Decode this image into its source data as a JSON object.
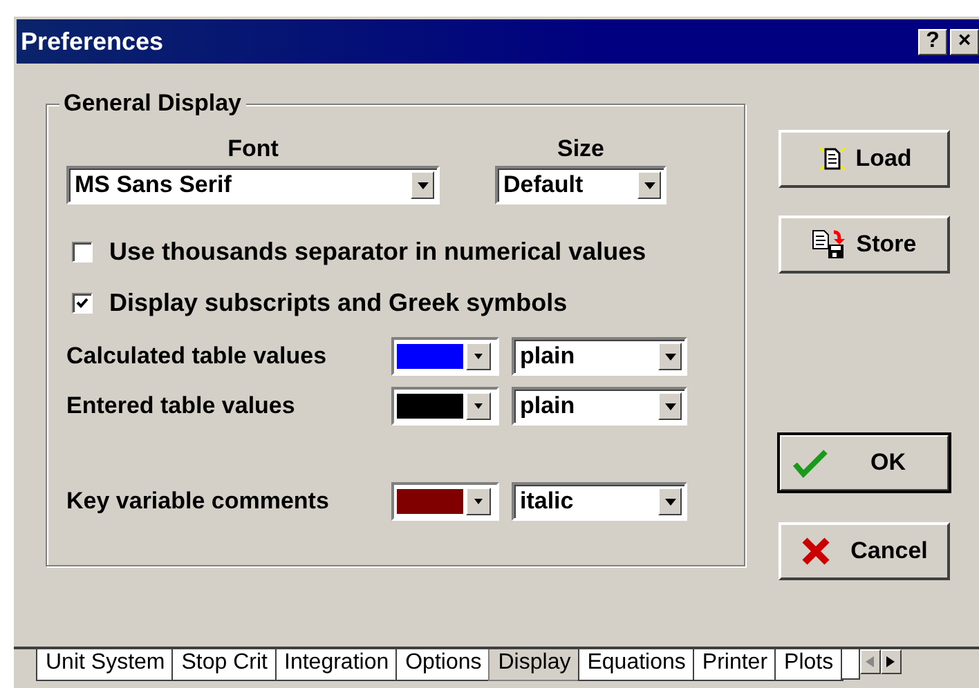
{
  "window": {
    "title": "Preferences",
    "help_button": "?",
    "close_button": "×"
  },
  "group": {
    "title": "General Display",
    "font": {
      "label": "Font",
      "value": "MS Sans Serif"
    },
    "size": {
      "label": "Size",
      "value": "Default"
    },
    "checkboxes": [
      {
        "label": "Use thousands separator in numerical values",
        "checked": false
      },
      {
        "label": "Display subscripts and Greek symbols",
        "checked": true
      }
    ],
    "styles": [
      {
        "label": "Calculated table values",
        "color": "#0000ff",
        "style": "plain"
      },
      {
        "label": "Entered table values",
        "color": "#000000",
        "style": "plain"
      },
      {
        "label": "Key variable comments",
        "color": "#800000",
        "style": "italic"
      }
    ]
  },
  "buttons": [
    {
      "kind": "load",
      "label": "Load"
    },
    {
      "kind": "store",
      "label": "Store"
    },
    {
      "kind": "ok",
      "label": "OK"
    },
    {
      "kind": "cancel",
      "label": "Cancel"
    }
  ],
  "tabs": [
    {
      "label": "Unit System",
      "selected": false
    },
    {
      "label": "Stop Crit",
      "selected": false
    },
    {
      "label": "Integration",
      "selected": false
    },
    {
      "label": "Options",
      "selected": false
    },
    {
      "label": "Display",
      "selected": true
    },
    {
      "label": "Equations",
      "selected": false
    },
    {
      "label": "Printer",
      "selected": false
    },
    {
      "label": "Plots",
      "selected": false
    }
  ]
}
